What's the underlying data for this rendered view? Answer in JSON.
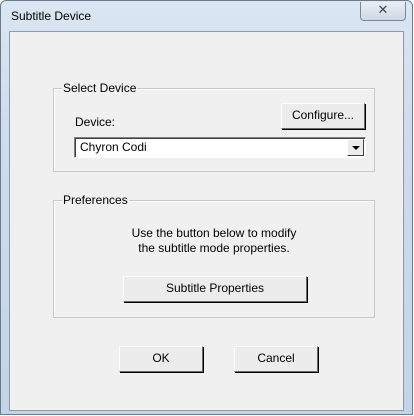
{
  "window": {
    "title": "Subtitle Device",
    "close_glyph": "✕"
  },
  "select_device": {
    "group_label": "Select Device",
    "device_label": "Device:",
    "configure_label": "Configure...",
    "device_value": "Chyron Codi"
  },
  "preferences": {
    "group_label": "Preferences",
    "description_line1": "Use the button below to modify",
    "description_line2": "the subtitle mode properties.",
    "subtitle_properties_label": "Subtitle Properties"
  },
  "buttons": {
    "ok_label": "OK",
    "cancel_label": "Cancel"
  }
}
